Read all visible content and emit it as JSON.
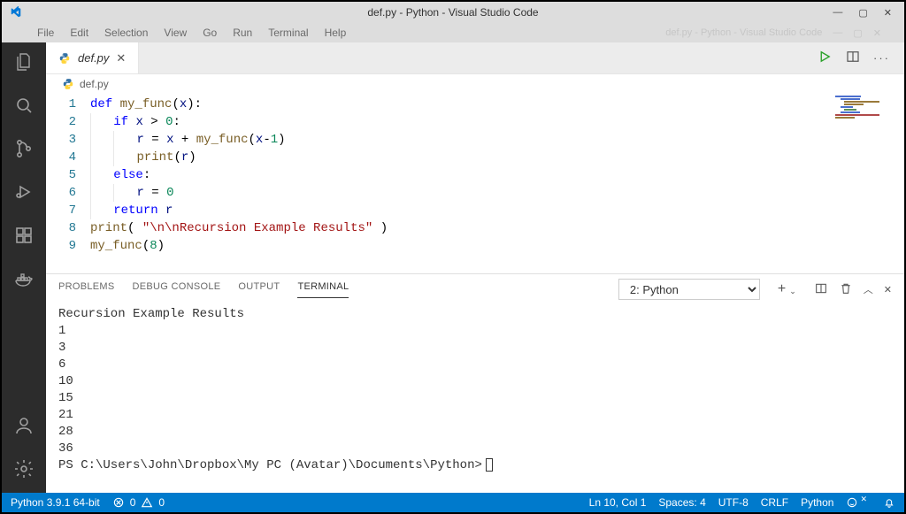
{
  "window": {
    "title": "def.py - Python - Visual Studio Code",
    "ghost_title": "def.py - Python - Visual Studio Code",
    "min": "—",
    "max": "▢",
    "close": "✕"
  },
  "menu": {
    "items": [
      "File",
      "Edit",
      "Selection",
      "View",
      "Go",
      "Run",
      "Terminal",
      "Help"
    ]
  },
  "activity": {
    "icons": [
      "files-icon",
      "search-icon",
      "source-control-icon",
      "debug-icon",
      "extensions-icon",
      "docker-icon",
      "account-icon",
      "gear-icon"
    ]
  },
  "tabs": {
    "active": {
      "label": "def.py",
      "icon": "python-file-icon"
    }
  },
  "breadcrumb": {
    "icon": "python-file-icon",
    "path": "def.py"
  },
  "editor": {
    "lines": [
      {
        "n": 1,
        "indent": 0,
        "tokens": [
          [
            "kw",
            "def"
          ],
          [
            "sp",
            " "
          ],
          [
            "fn",
            "my_func"
          ],
          [
            "op",
            "("
          ],
          [
            "var",
            "x"
          ],
          [
            "op",
            ")"
          ],
          [
            "op",
            ":"
          ]
        ]
      },
      {
        "n": 2,
        "indent": 1,
        "tokens": [
          [
            "kw",
            "if"
          ],
          [
            "sp",
            " "
          ],
          [
            "var",
            "x"
          ],
          [
            "sp",
            " "
          ],
          [
            "op",
            ">"
          ],
          [
            "sp",
            " "
          ],
          [
            "num",
            "0"
          ],
          [
            "op",
            ":"
          ]
        ]
      },
      {
        "n": 3,
        "indent": 2,
        "tokens": [
          [
            "var",
            "r"
          ],
          [
            "sp",
            " "
          ],
          [
            "op",
            "="
          ],
          [
            "sp",
            " "
          ],
          [
            "var",
            "x"
          ],
          [
            "sp",
            " "
          ],
          [
            "op",
            "+"
          ],
          [
            "sp",
            " "
          ],
          [
            "fn",
            "my_func"
          ],
          [
            "op",
            "("
          ],
          [
            "var",
            "x"
          ],
          [
            "op",
            "-"
          ],
          [
            "num",
            "1"
          ],
          [
            "op",
            ")"
          ]
        ]
      },
      {
        "n": 4,
        "indent": 2,
        "tokens": [
          [
            "fn",
            "print"
          ],
          [
            "op",
            "("
          ],
          [
            "var",
            "r"
          ],
          [
            "op",
            ")"
          ]
        ]
      },
      {
        "n": 5,
        "indent": 1,
        "tokens": [
          [
            "kw",
            "else"
          ],
          [
            "op",
            ":"
          ]
        ]
      },
      {
        "n": 6,
        "indent": 2,
        "tokens": [
          [
            "var",
            "r"
          ],
          [
            "sp",
            " "
          ],
          [
            "op",
            "="
          ],
          [
            "sp",
            " "
          ],
          [
            "num",
            "0"
          ]
        ]
      },
      {
        "n": 7,
        "indent": 1,
        "tokens": [
          [
            "kw",
            "return"
          ],
          [
            "sp",
            " "
          ],
          [
            "var",
            "r"
          ]
        ]
      },
      {
        "n": 8,
        "indent": 0,
        "tokens": [
          [
            "fn",
            "print"
          ],
          [
            "op",
            "("
          ],
          [
            "sp",
            " "
          ],
          [
            "str",
            "\"\\n\\nRecursion Example Results\""
          ],
          [
            "sp",
            " "
          ],
          [
            "op",
            ")"
          ]
        ]
      },
      {
        "n": 9,
        "indent": 0,
        "tokens": [
          [
            "fn",
            "my_func"
          ],
          [
            "op",
            "("
          ],
          [
            "num",
            "8"
          ],
          [
            "op",
            ")"
          ]
        ]
      }
    ]
  },
  "panel": {
    "tabs": {
      "problems": "PROBLEMS",
      "debug": "DEBUG CONSOLE",
      "output": "OUTPUT",
      "terminal": "TERMINAL"
    },
    "terminal_selector": "2: Python",
    "terminal_lines": [
      "",
      "Recursion Example Results",
      "1",
      "3",
      "6",
      "10",
      "15",
      "21",
      "28",
      "36"
    ],
    "prompt": "PS C:\\Users\\John\\Dropbox\\My PC (Avatar)\\Documents\\Python>"
  },
  "status": {
    "python": "Python 3.9.1 64-bit",
    "errors": "0",
    "warnings": "0",
    "ln_col": "Ln 10, Col 1",
    "spaces": "Spaces: 4",
    "encoding": "UTF-8",
    "eol": "CRLF",
    "language": "Python",
    "feedback_icon": "feedback-icon",
    "bell_icon": "bell-icon"
  }
}
